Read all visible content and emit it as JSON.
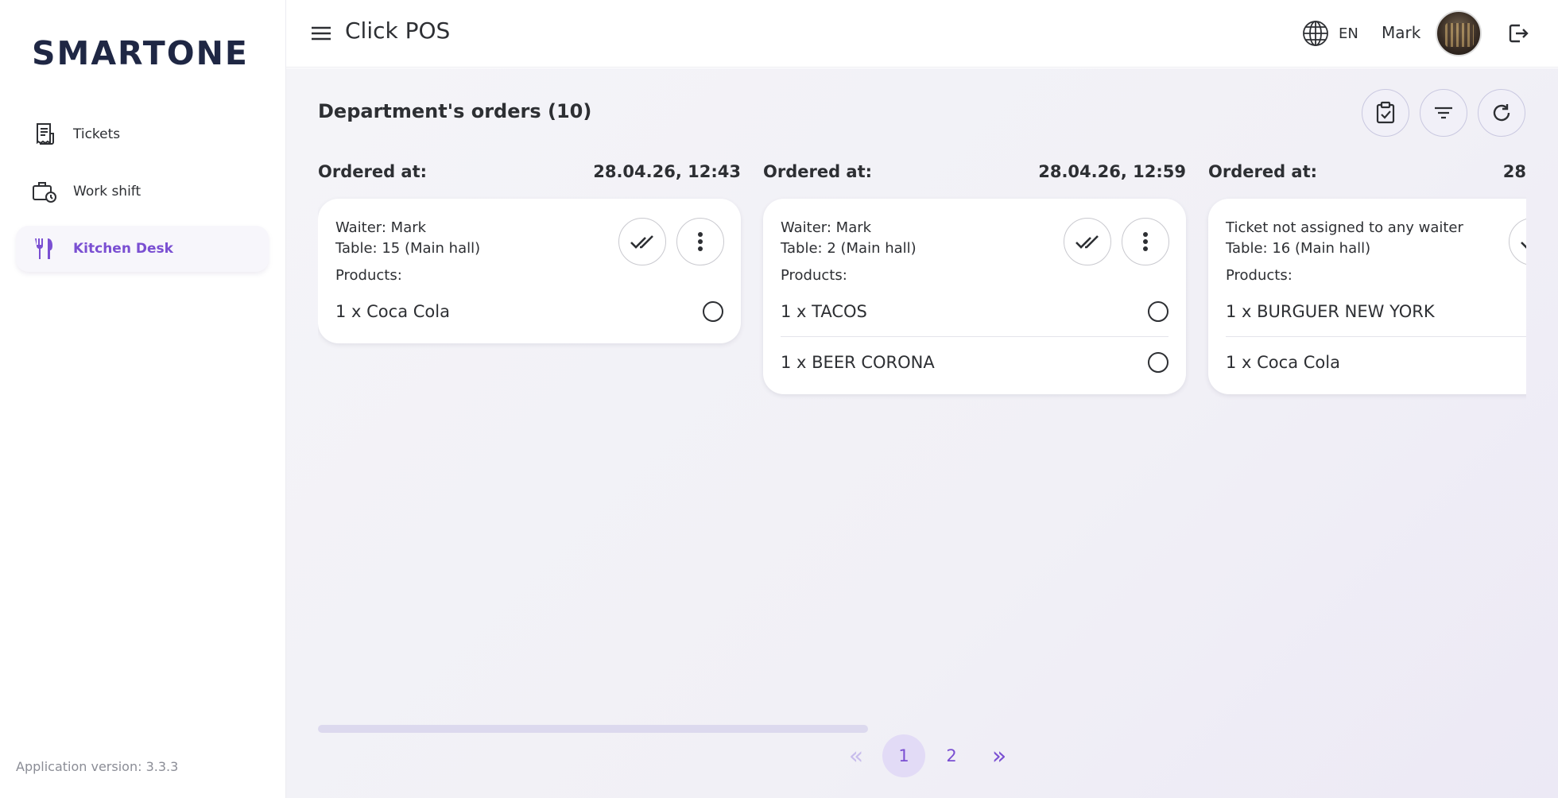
{
  "sidebar": {
    "logo": "SMARTONE",
    "items": [
      {
        "label": "Tickets",
        "icon": "receipt-icon",
        "active": false
      },
      {
        "label": "Work shift",
        "icon": "briefcase-clock-icon",
        "active": false
      },
      {
        "label": "Kitchen Desk",
        "icon": "fork-knife-icon",
        "active": true
      }
    ],
    "version": "Application version: 3.3.3"
  },
  "header": {
    "title": "Click POS",
    "language": "EN",
    "user": "Mark"
  },
  "main": {
    "title": "Department's orders (10)",
    "ordered_label": "Ordered at:",
    "products_label": "Products:",
    "orders": [
      {
        "time": "28.04.26, 12:43",
        "waiter": "Waiter: Mark",
        "table": "Table: 15 (Main hall)",
        "products": [
          "1 x Coca Cola"
        ]
      },
      {
        "time": "28.04.26, 12:59",
        "waiter": "Waiter: Mark",
        "table": "Table: 2 (Main hall)",
        "products": [
          "1 x TACOS",
          "1 x BEER CORONA"
        ]
      },
      {
        "time": "28",
        "waiter": "Ticket not assigned to any waiter",
        "table": "Table: 16 (Main hall)",
        "products": [
          "1 x BURGUER NEW YORK",
          "1 x Coca Cola"
        ]
      }
    ],
    "pagination": {
      "prev": "«",
      "pages": [
        "1",
        "2"
      ],
      "current": "1",
      "next": "»"
    }
  },
  "colors": {
    "accent": "#7a4fd2",
    "text": "#2d2f33",
    "logo": "#1f2744"
  }
}
